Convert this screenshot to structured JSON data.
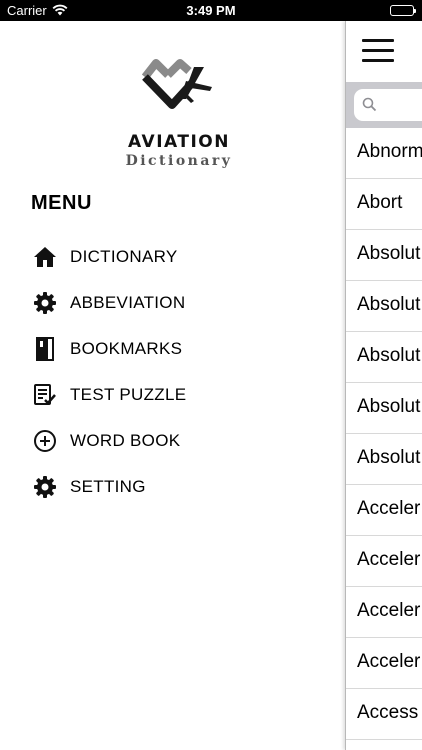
{
  "status_bar": {
    "carrier": "Carrier",
    "time": "3:49 PM"
  },
  "logo": {
    "line1": "AVIATION",
    "line2": "Dictionary"
  },
  "menu": {
    "title": "MENU",
    "items": [
      {
        "label": "DICTIONARY",
        "icon": "home-icon"
      },
      {
        "label": "ABBEVIATION",
        "icon": "gear-icon"
      },
      {
        "label": "BOOKMARKS",
        "icon": "book-icon"
      },
      {
        "label": "TEST PUZZLE",
        "icon": "checklist-icon"
      },
      {
        "label": "WORD BOOK",
        "icon": "plus-circle-icon"
      },
      {
        "label": "SETTING",
        "icon": "gear-icon"
      }
    ]
  },
  "main": {
    "search": {
      "placeholder": ""
    },
    "words": [
      "Abnorm",
      "Abort",
      "Absolut",
      "Absolut",
      "Absolut",
      "Absolut",
      "Absolut",
      "Acceler",
      "Acceler",
      "Acceler",
      "Acceler",
      "Access"
    ]
  },
  "colors": {
    "status_bar_bg": "#000000",
    "search_bar_bg": "#c9c9ce",
    "divider": "#d8d8d8"
  }
}
